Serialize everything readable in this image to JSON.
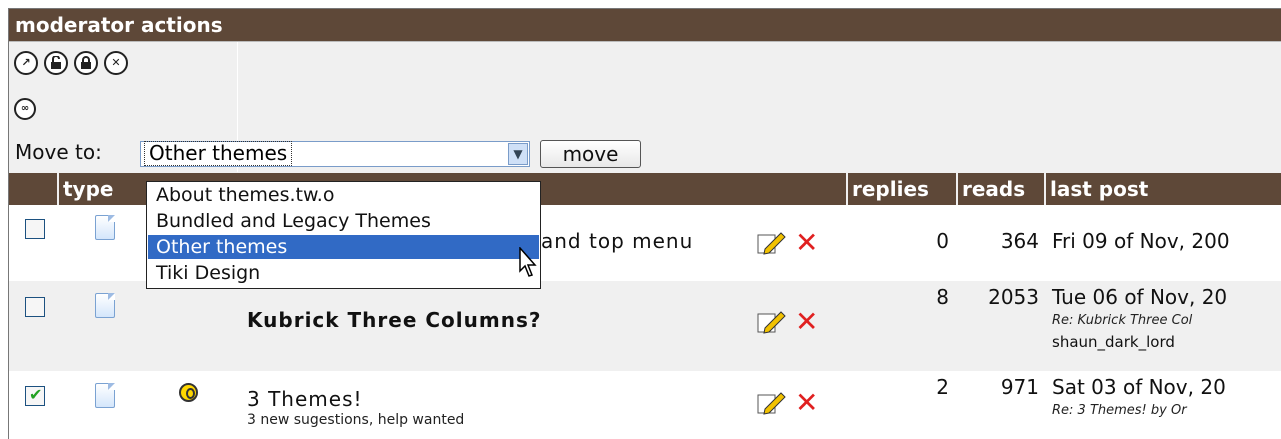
{
  "header": {
    "title": "moderator actions"
  },
  "mod_icons": [
    {
      "name": "move-icon",
      "glyph": "↗"
    },
    {
      "name": "unlock-icon",
      "glyph": "🔓"
    },
    {
      "name": "lock-icon",
      "glyph": "🔒"
    },
    {
      "name": "close-icon",
      "glyph": "✕"
    },
    {
      "name": "merge-icon",
      "glyph": "∞"
    }
  ],
  "move": {
    "label": "Move to:",
    "selected": "Other themes",
    "button_label": "move",
    "options": [
      "About themes.tw.o",
      "Bundled and Legacy Themes",
      "Other themes",
      "Tiki Design"
    ],
    "highlighted_index": 2
  },
  "table": {
    "headers": {
      "check": "",
      "type": "type",
      "replies": "replies",
      "reads": "reads",
      "last_post": "last post"
    },
    "rows": [
      {
        "checked": false,
        "title": "and top menu",
        "title_partial_hidden": true,
        "replies": "0",
        "reads": "364",
        "last_post": "Fri 09 of Nov, 200"
      },
      {
        "checked": false,
        "title": "Kubrick Three Columns?",
        "bold": true,
        "replies": "8",
        "reads": "2053",
        "last_post": "Tue 06 of Nov, 20",
        "last_post_re": "Re: Kubrick Three Col",
        "last_post_user": "shaun_dark_lord"
      },
      {
        "checked": true,
        "title": "3 Themes!",
        "subtitle": "3 new sugestions, help wanted",
        "hot": true,
        "replies": "2",
        "reads": "971",
        "last_post": "Sat 03 of Nov, 20",
        "last_post_re": "Re: 3 Themes! by Or"
      }
    ]
  },
  "colors": {
    "header_bg": "#5e4838",
    "highlight": "#316ac5",
    "delete": "#e02020"
  }
}
